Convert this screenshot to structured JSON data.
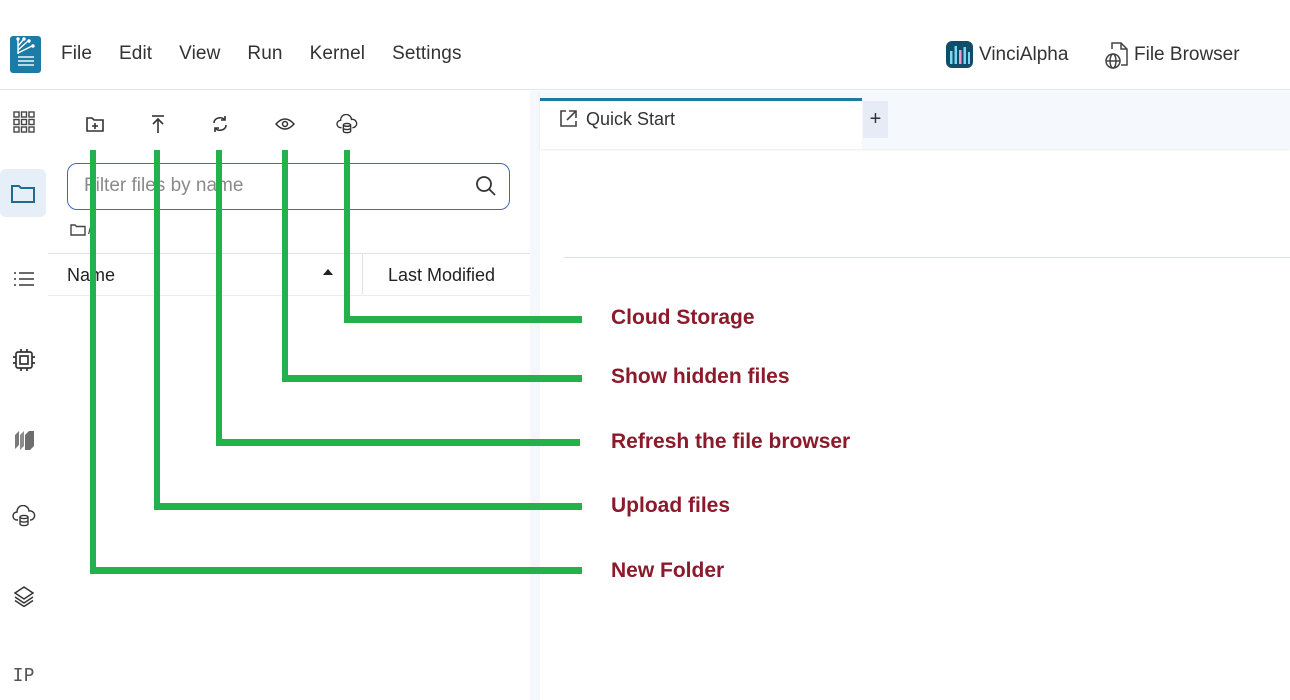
{
  "topbar": {
    "app_logo": "notebook-tree-logo",
    "menu": [
      "File",
      "Edit",
      "View",
      "Run",
      "Kernel",
      "Settings"
    ],
    "brand_label": "VinciAlpha",
    "file_browser_label": "File Browser"
  },
  "activity_bar": {
    "items": [
      {
        "icon": "grid-apps-icon",
        "active": false
      },
      {
        "icon": "folder-icon",
        "active": true
      },
      {
        "icon": "list-icon",
        "active": false
      },
      {
        "icon": "cpu-chip-icon",
        "active": false
      },
      {
        "icon": "stacked-books-icon",
        "active": false
      },
      {
        "icon": "cloud-database-icon",
        "active": false
      },
      {
        "icon": "layers-icon",
        "active": false
      }
    ],
    "ip_label": "IP"
  },
  "file_browser": {
    "toolbar": [
      {
        "icon": "new-folder-icon",
        "tooltip": "New Folder"
      },
      {
        "icon": "upload-icon",
        "tooltip": "Upload files"
      },
      {
        "icon": "refresh-icon",
        "tooltip": "Refresh the file browser"
      },
      {
        "icon": "eye-icon",
        "tooltip": "Show hidden files"
      },
      {
        "icon": "cloud-storage-icon",
        "tooltip": "Cloud Storage"
      }
    ],
    "search": {
      "placeholder": "Filter files by name",
      "value": ""
    },
    "breadcrumb": "/",
    "columns": {
      "name": "Name",
      "last_modified": "Last Modified",
      "sort": "ascending"
    },
    "files": []
  },
  "main": {
    "tabs": [
      {
        "label": "Quick Start",
        "icon": "external-link-icon",
        "active": true
      }
    ],
    "add_tab_label": "+"
  },
  "annotations": {
    "color_line": "#22b14c",
    "color_text": "#8b1a2b",
    "labels": [
      "Cloud Storage",
      "Show hidden files",
      "Refresh the file browser",
      "Upload files",
      "New Folder"
    ]
  }
}
